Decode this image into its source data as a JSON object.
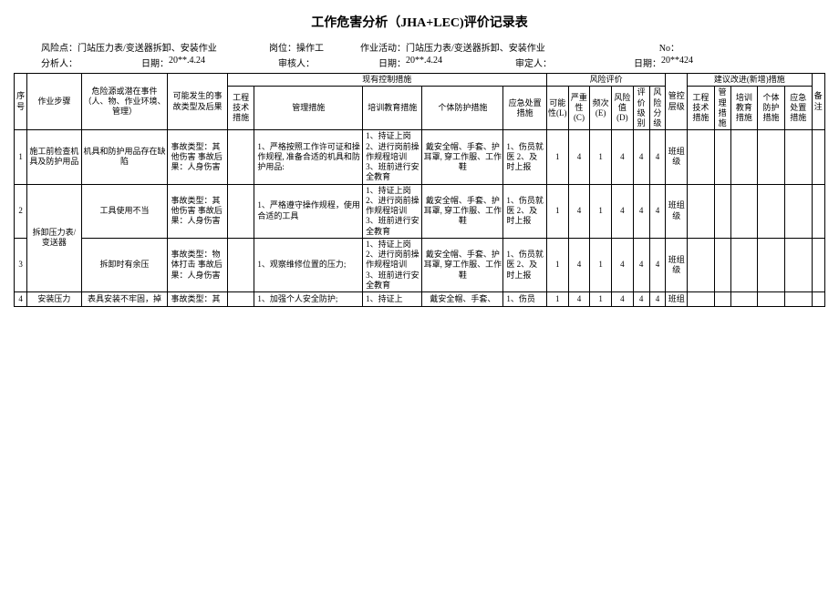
{
  "title": "工作危害分析（JHA+LEC)评价记录表",
  "header": {
    "risk_point_label": "风险点：",
    "risk_point": "门站压力表/变送器拆卸、安装作业",
    "post_label": "岗位：",
    "post": "操作工",
    "activity_label": "作业活动：",
    "activity": "门站压力表/变送器拆卸、安装作业",
    "no_label": "No：",
    "analyst_label": "分析人：",
    "date_label": "日期：",
    "date1": "20**.4.24",
    "reviewer_label": "审核人：",
    "date2": "20**.4.24",
    "approver_label": "审定人：",
    "date3": "20**424"
  },
  "cols": {
    "seq": "序号",
    "step": "作业步骤",
    "source": "危险源或潜在事件（人、物、作业环境、管理）",
    "accident": "可能发生的事故类型及后果",
    "current": "现有控制措施",
    "c_eng": "工程技术措施",
    "c_mgmt": "管理措施",
    "c_train": "培训教育措施",
    "c_ppe": "个体防护措施",
    "c_emg": "应急处置措施",
    "risk": "风险评价",
    "r_l": "可能性(L)",
    "r_c": "严重性(C)",
    "r_e": "频次(E)",
    "r_d": "风险值(D)",
    "r_lv": "评价级别",
    "r_rl": "风险分级",
    "ctrl_lv": "管控层级",
    "suggest": "建议改进(新增)措施",
    "s_eng": "工程技术措施",
    "s_mgmt": "管理措施",
    "s_train": "培训教育措施",
    "s_ppe": "个体防护措施",
    "s_emg": "应急处置措施",
    "note": "备注"
  },
  "rows": [
    {
      "seq": "1",
      "step": "施工前检查机具及防护用品",
      "source": "机具和防护用品存在缺陷",
      "accident": "事故类型：其他伤害\n事故后果：人身伤害",
      "mgmt": "1、严格按照工作许可证和操作规程, 准备合适的机具和防护用品:",
      "train": "1、持证上岗\n2、进行岗前操作规程培训\n3、班前进行安全教育",
      "ppe": "戴安全帽、手套、护耳罩, 穿工作服、工作鞋",
      "emg": "1、伤员就医\n2、及时上报",
      "L": "1",
      "C": "4",
      "E": "1",
      "D": "4",
      "lv": "4",
      "rl": "4",
      "ctrl": "班组级"
    },
    {
      "seq": "2",
      "step": "拆卸压力表/变送器",
      "source": "工具使用不当",
      "accident": "事故类型：其他伤害\n事故后果：人身伤害",
      "mgmt": "1、严格遵守操作规程，使用合适的工具",
      "train": "1、持证上岗\n2、进行岗前操作规程培训\n3、班前进行安全教育",
      "ppe": "戴安全帽、手套、护耳罩, 穿工作服、工作鞋",
      "emg": "1、伤员就医\n2、及时上报",
      "L": "1",
      "C": "4",
      "E": "1",
      "D": "4",
      "lv": "4",
      "rl": "4",
      "ctrl": "班组级"
    },
    {
      "seq": "3",
      "step": "",
      "source": "拆卸时有余压",
      "accident": "事故类型：物体打击\n事故后果：人身伤害",
      "mgmt": "1、观察维修位置的压力;",
      "train": "1、持证上岗\n2、进行岗前操作规程培训\n3、班前进行安全教育",
      "ppe": "戴安全帽、手套、护耳罩, 穿工作服、工作鞋",
      "emg": "1、伤员就医\n2、及时上报",
      "L": "1",
      "C": "4",
      "E": "1",
      "D": "4",
      "lv": "4",
      "rl": "4",
      "ctrl": "班组级"
    },
    {
      "seq": "4",
      "step": "安装压力",
      "source": "表具安装不牢固，掉",
      "accident": "事故类型：其",
      "mgmt": "1、加强个人安全防护;",
      "train": "1、持证上",
      "ppe": "戴安全帽、手套、",
      "emg": "1、伤员",
      "L": "1",
      "C": "4",
      "E": "1",
      "D": "4",
      "lv": "4",
      "rl": "4",
      "ctrl": "班组"
    }
  ]
}
